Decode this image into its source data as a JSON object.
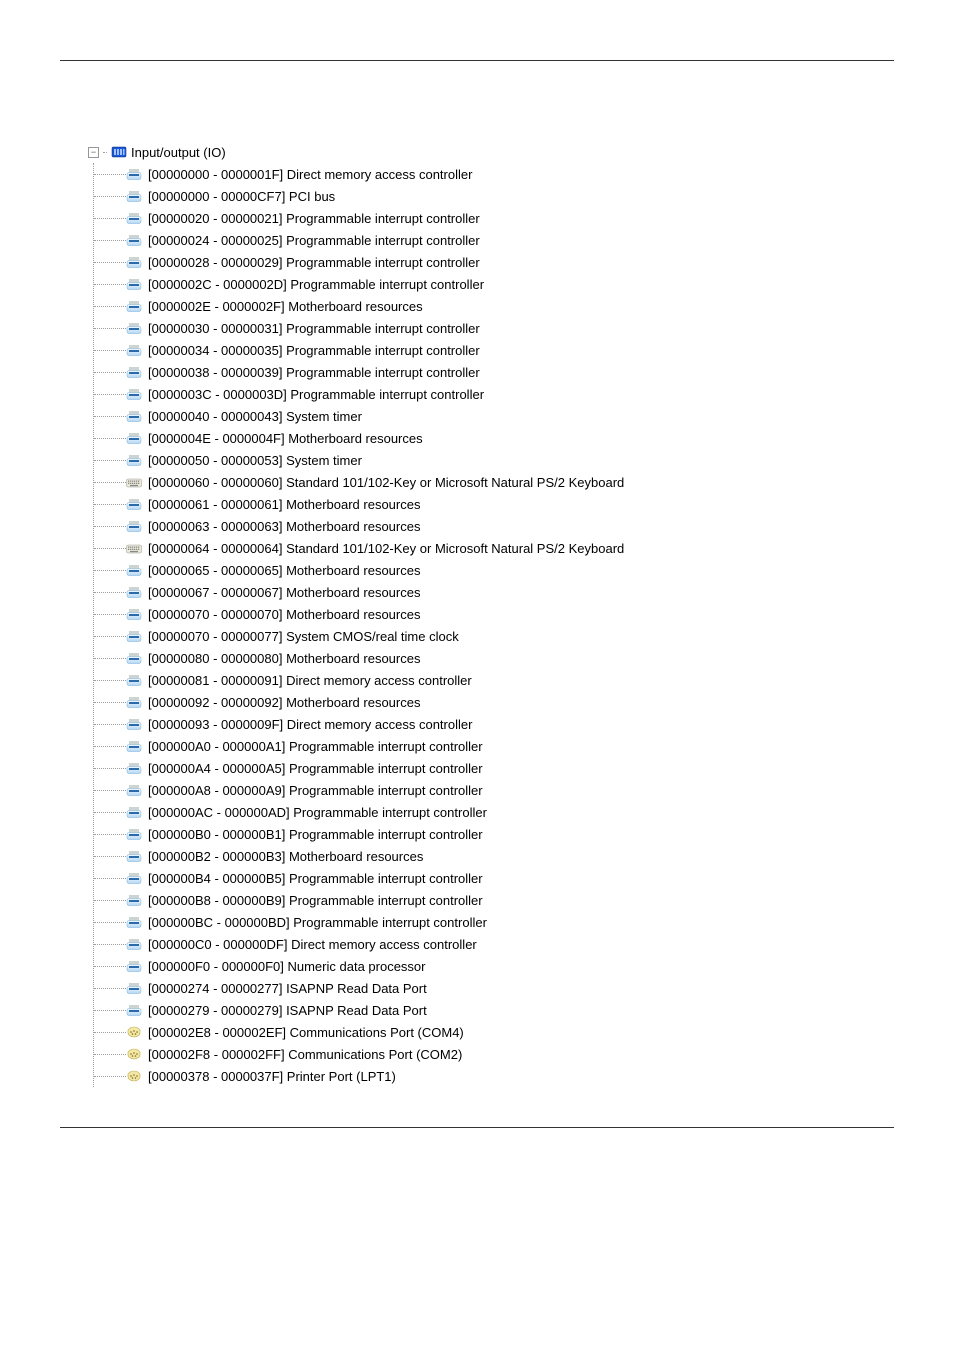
{
  "root": {
    "label": "Input/output (IO)",
    "icon": "io-category-icon"
  },
  "items": [
    {
      "icon": "chip",
      "label": "[00000000 - 0000001F]  Direct memory access controller"
    },
    {
      "icon": "chip",
      "label": "[00000000 - 00000CF7]  PCI bus"
    },
    {
      "icon": "chip",
      "label": "[00000020 - 00000021]  Programmable interrupt controller"
    },
    {
      "icon": "chip",
      "label": "[00000024 - 00000025]  Programmable interrupt controller"
    },
    {
      "icon": "chip",
      "label": "[00000028 - 00000029]  Programmable interrupt controller"
    },
    {
      "icon": "chip",
      "label": "[0000002C - 0000002D]  Programmable interrupt controller"
    },
    {
      "icon": "chip",
      "label": "[0000002E - 0000002F]  Motherboard resources"
    },
    {
      "icon": "chip",
      "label": "[00000030 - 00000031]  Programmable interrupt controller"
    },
    {
      "icon": "chip",
      "label": "[00000034 - 00000035]  Programmable interrupt controller"
    },
    {
      "icon": "chip",
      "label": "[00000038 - 00000039]  Programmable interrupt controller"
    },
    {
      "icon": "chip",
      "label": "[0000003C - 0000003D]  Programmable interrupt controller"
    },
    {
      "icon": "chip",
      "label": "[00000040 - 00000043]  System timer"
    },
    {
      "icon": "chip",
      "label": "[0000004E - 0000004F]  Motherboard resources"
    },
    {
      "icon": "chip",
      "label": "[00000050 - 00000053]  System timer"
    },
    {
      "icon": "keyboard",
      "label": "[00000060 - 00000060]  Standard 101/102-Key or Microsoft Natural PS/2 Keyboard"
    },
    {
      "icon": "chip",
      "label": "[00000061 - 00000061]  Motherboard resources"
    },
    {
      "icon": "chip",
      "label": "[00000063 - 00000063]  Motherboard resources"
    },
    {
      "icon": "keyboard",
      "label": "[00000064 - 00000064]  Standard 101/102-Key or Microsoft Natural PS/2 Keyboard"
    },
    {
      "icon": "chip",
      "label": "[00000065 - 00000065]  Motherboard resources"
    },
    {
      "icon": "chip",
      "label": "[00000067 - 00000067]  Motherboard resources"
    },
    {
      "icon": "chip",
      "label": "[00000070 - 00000070]  Motherboard resources"
    },
    {
      "icon": "chip",
      "label": "[00000070 - 00000077]  System CMOS/real time clock"
    },
    {
      "icon": "chip",
      "label": "[00000080 - 00000080]  Motherboard resources"
    },
    {
      "icon": "chip",
      "label": "[00000081 - 00000091]  Direct memory access controller"
    },
    {
      "icon": "chip",
      "label": "[00000092 - 00000092]  Motherboard resources"
    },
    {
      "icon": "chip",
      "label": "[00000093 - 0000009F]  Direct memory access controller"
    },
    {
      "icon": "chip",
      "label": "[000000A0 - 000000A1]  Programmable interrupt controller"
    },
    {
      "icon": "chip",
      "label": "[000000A4 - 000000A5]  Programmable interrupt controller"
    },
    {
      "icon": "chip",
      "label": "[000000A8 - 000000A9]  Programmable interrupt controller"
    },
    {
      "icon": "chip",
      "label": "[000000AC - 000000AD]  Programmable interrupt controller"
    },
    {
      "icon": "chip",
      "label": "[000000B0 - 000000B1]  Programmable interrupt controller"
    },
    {
      "icon": "chip",
      "label": "[000000B2 - 000000B3]  Motherboard resources"
    },
    {
      "icon": "chip",
      "label": "[000000B4 - 000000B5]  Programmable interrupt controller"
    },
    {
      "icon": "chip",
      "label": "[000000B8 - 000000B9]  Programmable interrupt controller"
    },
    {
      "icon": "chip",
      "label": "[000000BC - 000000BD]  Programmable interrupt controller"
    },
    {
      "icon": "chip",
      "label": "[000000C0 - 000000DF]  Direct memory access controller"
    },
    {
      "icon": "chip",
      "label": "[000000F0 - 000000F0]  Numeric data processor"
    },
    {
      "icon": "chip",
      "label": "[00000274 - 00000277]  ISAPNP Read Data Port"
    },
    {
      "icon": "chip",
      "label": "[00000279 - 00000279]  ISAPNP Read Data Port"
    },
    {
      "icon": "port",
      "label": "[000002E8 - 000002EF]  Communications Port (COM4)"
    },
    {
      "icon": "port",
      "label": "[000002F8 - 000002FF]  Communications Port (COM2)"
    },
    {
      "icon": "port",
      "label": "[00000378 - 0000037F]  Printer Port (LPT1)"
    }
  ]
}
